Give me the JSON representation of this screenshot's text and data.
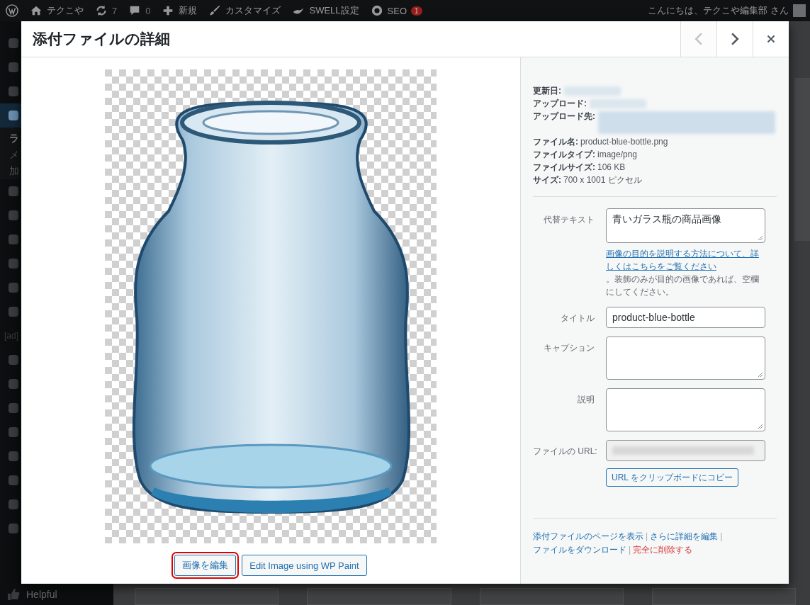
{
  "admin_bar": {
    "items": [
      {
        "kind": "wp"
      },
      {
        "kind": "home",
        "label": "テクこや"
      },
      {
        "kind": "updates",
        "label": "7"
      },
      {
        "kind": "comments",
        "label": "0"
      },
      {
        "kind": "new",
        "label": "新規"
      },
      {
        "kind": "customize",
        "label": "カスタマイズ"
      },
      {
        "kind": "swell",
        "label": "SWELL設定"
      },
      {
        "kind": "seo",
        "label": "SEO",
        "badge": "1"
      }
    ],
    "greeting": "こんにちは、テクこや編集部 さん"
  },
  "sidebar": {
    "items": [
      {
        "kind": "icon",
        "selected": false
      },
      {
        "kind": "icon",
        "selected": false
      },
      {
        "kind": "icon",
        "selected": false
      },
      {
        "kind": "icon",
        "selected": true
      },
      {
        "kind": "sub",
        "label": "ラ",
        "selected": true
      },
      {
        "kind": "sub",
        "label": "メ",
        "selected": false
      },
      {
        "kind": "sub",
        "label": "加",
        "selected": false
      },
      {
        "kind": "icon",
        "selected": false
      },
      {
        "kind": "icon",
        "selected": false
      },
      {
        "kind": "icon",
        "selected": false
      },
      {
        "kind": "icon",
        "selected": false
      },
      {
        "kind": "icon",
        "selected": false
      },
      {
        "kind": "icon",
        "selected": false
      },
      {
        "kind": "text",
        "label": "[ad]",
        "selected": false
      },
      {
        "kind": "icon",
        "selected": false
      },
      {
        "kind": "icon",
        "selected": false
      },
      {
        "kind": "icon",
        "selected": false
      },
      {
        "kind": "icon",
        "selected": false
      },
      {
        "kind": "icon",
        "selected": false
      },
      {
        "kind": "icon",
        "selected": false
      },
      {
        "kind": "icon",
        "selected": false
      },
      {
        "kind": "icon",
        "selected": false
      },
      {
        "kind": "labeled",
        "label": "Helpful",
        "selected": false
      }
    ]
  },
  "modal": {
    "title": "添付ファイルの詳細",
    "nav": [
      {
        "kind": "prev",
        "disabled": true
      },
      {
        "kind": "next",
        "disabled": false
      },
      {
        "kind": "close",
        "disabled": false
      }
    ],
    "image_buttons": [
      {
        "label": "画像を編集",
        "highlighted": true
      },
      {
        "label": "Edit Image using WP Paint",
        "highlighted": false
      }
    ],
    "details": [
      {
        "kind": "blurred",
        "label": "更新日:"
      },
      {
        "kind": "blurred",
        "label": "アップロード:"
      },
      {
        "kind": "blurred-long",
        "label": "アップロード先:"
      },
      {
        "kind": "text",
        "label": "ファイル名:",
        "value": "product-blue-bottle.png"
      },
      {
        "kind": "text",
        "label": "ファイルタイプ:",
        "value": "image/png"
      },
      {
        "kind": "text",
        "label": "ファイルサイズ:",
        "value": "106 KB"
      },
      {
        "kind": "text",
        "label": "サイズ:",
        "value": "700 x 1001 ピクセル"
      }
    ],
    "fields": [
      {
        "kind": "textarea",
        "label": "代替テキスト",
        "value": "青いガラス瓶の商品画像",
        "help_link": "画像の目的を説明する方法について、詳しくはこちらをご覧ください",
        "help_text": "。装飾のみが目的の画像であれば、空欄にしてください。"
      },
      {
        "kind": "input",
        "label": "タイトル",
        "value": "product-blue-bottle"
      },
      {
        "kind": "textarea",
        "label": "キャプション"
      },
      {
        "kind": "textarea",
        "label": "説明"
      },
      {
        "kind": "url",
        "label": "ファイルの URL:",
        "button": "URL をクリップボードにコピー"
      }
    ],
    "actions": [
      {
        "kind": "link",
        "label": "添付ファイルのページを表示"
      },
      {
        "kind": "separator",
        "label": "|"
      },
      {
        "kind": "link",
        "label": "さらに詳細を編集"
      },
      {
        "kind": "separator",
        "label": "|"
      },
      {
        "kind": "link",
        "label": "ファイルをダウンロード"
      },
      {
        "kind": "separator",
        "label": "|"
      },
      {
        "kind": "danger",
        "label": "完全に削除する"
      }
    ]
  }
}
